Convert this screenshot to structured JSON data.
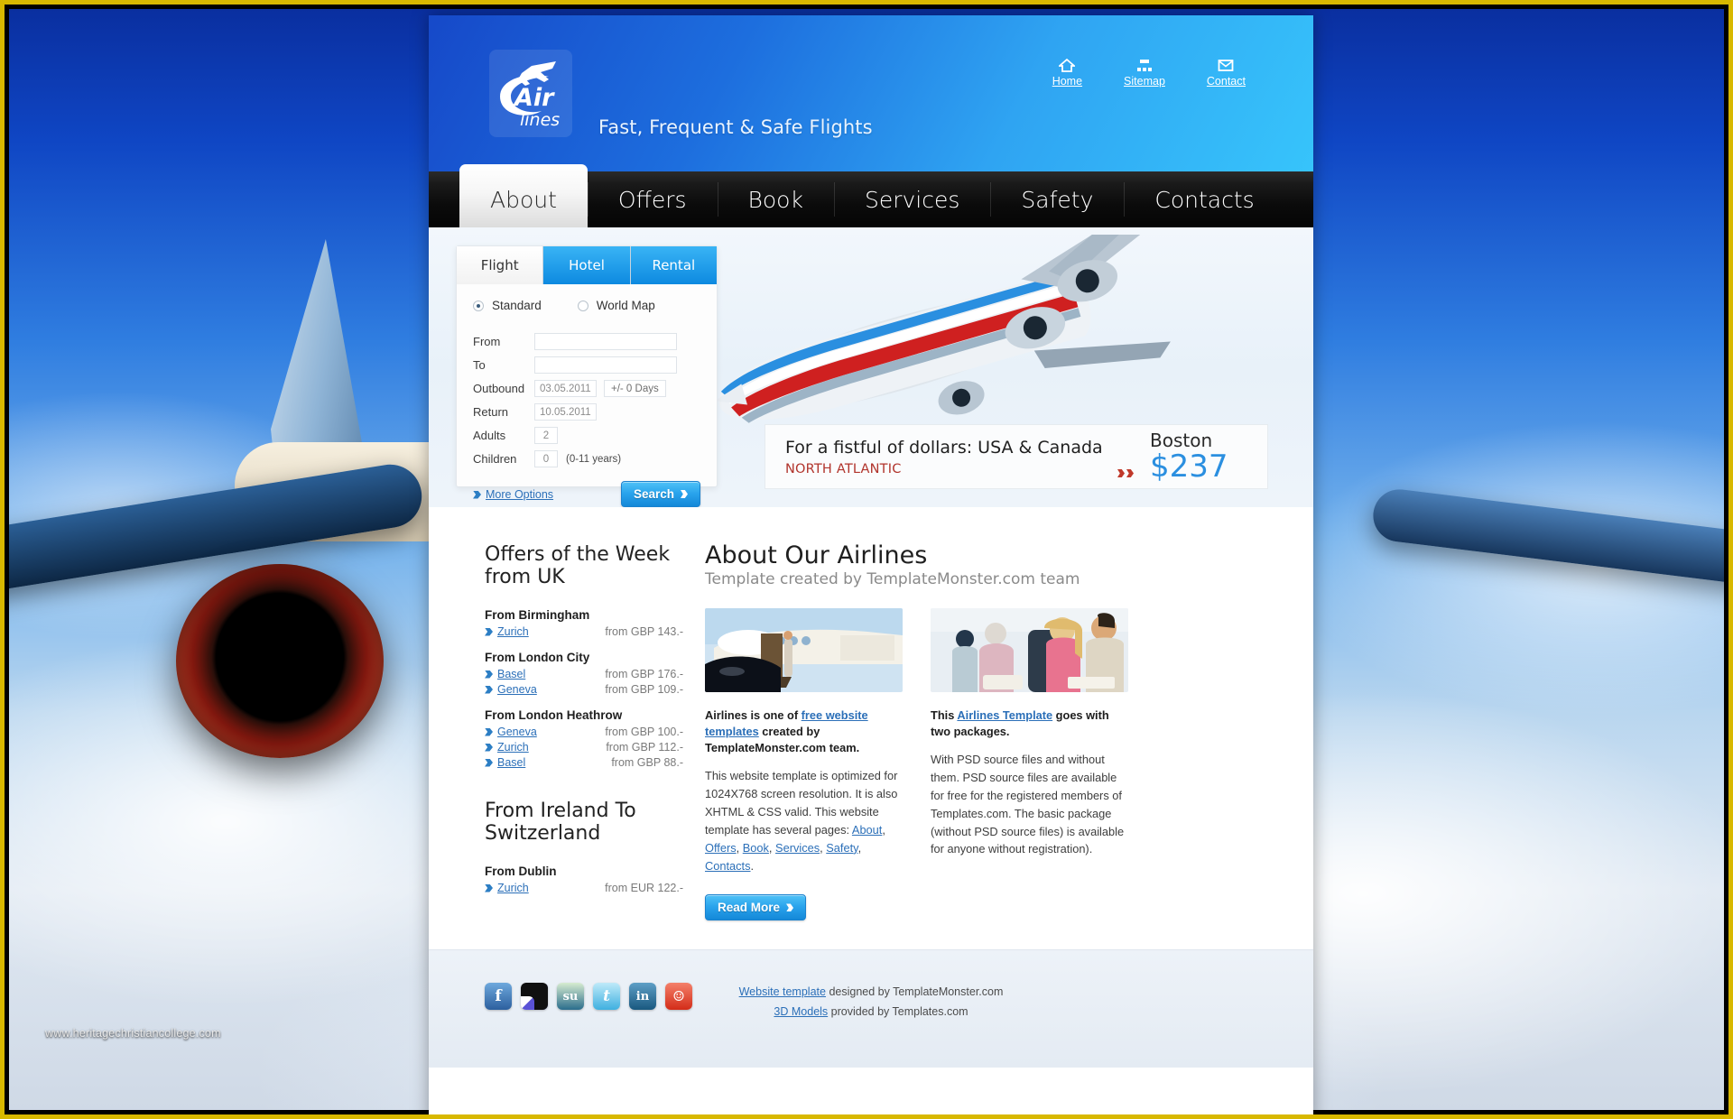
{
  "background": {
    "watermark": "www.heritagechristiancollege.com",
    "frame_color": "#d8b800"
  },
  "header": {
    "logo_top": "Air",
    "logo_bottom": "lines",
    "tagline": "Fast, Frequent & Safe Flights",
    "top_links": [
      {
        "label": "Home",
        "icon": "home-icon"
      },
      {
        "label": "Sitemap",
        "icon": "sitemap-icon"
      },
      {
        "label": "Contact",
        "icon": "envelope-icon"
      }
    ]
  },
  "nav": {
    "items": [
      {
        "label": "About",
        "active": true
      },
      {
        "label": "Offers",
        "active": false
      },
      {
        "label": "Book",
        "active": false
      },
      {
        "label": "Services",
        "active": false
      },
      {
        "label": "Safety",
        "active": false
      },
      {
        "label": "Contacts",
        "active": false
      }
    ]
  },
  "booking": {
    "tabs": [
      {
        "label": "Flight",
        "active": true
      },
      {
        "label": "Hotel",
        "active": false
      },
      {
        "label": "Rental",
        "active": false
      }
    ],
    "modes": [
      {
        "label": "Standard",
        "selected": true
      },
      {
        "label": "World Map",
        "selected": false
      }
    ],
    "fields": {
      "from_label": "From",
      "from_value": "",
      "to_label": "To",
      "to_value": "",
      "outbound_label": "Outbound",
      "outbound_value": "03.05.2011",
      "return_label": "Return",
      "return_value": "10.05.2011",
      "days_note": "+/- 0 Days",
      "adults_label": "Adults",
      "adults_value": "2",
      "children_label": "Children",
      "children_value": "0",
      "children_note": "(0-11 years)"
    },
    "more_options": "More Options",
    "search_button": "Search"
  },
  "offer_strip": {
    "title": "For a fistful of dollars: USA & Canada",
    "subtitle": "NORTH ATLANTIC",
    "city": "Boston",
    "price": "$237"
  },
  "sidebar": {
    "heading_1": "Offers of the Week from UK",
    "groups_1": [
      {
        "title": "From Birmingham",
        "rows": [
          {
            "city": "Zurich",
            "price": "from GBP 143.-"
          }
        ]
      },
      {
        "title": "From London City",
        "rows": [
          {
            "city": "Basel",
            "price": "from GBP 176.-"
          },
          {
            "city": "Geneva",
            "price": "from GBP 109.-"
          }
        ]
      },
      {
        "title": "From London Heathrow",
        "rows": [
          {
            "city": "Geneva",
            "price": "from GBP 100.-"
          },
          {
            "city": "Zurich",
            "price": "from GBP 112.-"
          },
          {
            "city": "Basel",
            "price": "from GBP 88.-"
          }
        ]
      }
    ],
    "heading_2": "From Ireland To Switzerland",
    "groups_2": [
      {
        "title": "From Dublin",
        "rows": [
          {
            "city": "Zurich",
            "price": "from EUR 122.-"
          }
        ]
      }
    ]
  },
  "about": {
    "title": "About Our Airlines",
    "subtitle": "Template created by TemplateMonster.com team",
    "left": {
      "lead_pre": "Airlines is one of ",
      "lead_link": "free website templates",
      "lead_post": " created by TemplateMonster.com team.",
      "body_pre": "This website template is optimized for 1024X768 screen resolution. It is also XHTML & CSS valid. This website template has several pages: ",
      "page_links": [
        "About",
        "Offers",
        "Book",
        "Services",
        "Safety",
        "Contacts"
      ]
    },
    "right": {
      "lead_pre": "This ",
      "lead_link": "Airlines Template",
      "lead_post": " goes with two packages.",
      "body": "With PSD source files and without them. PSD source files are available for free for the registered members of Templates.com. The basic package (without PSD source files) is available for anyone without registration)."
    },
    "read_more": "Read More"
  },
  "footer": {
    "social": [
      {
        "name": "facebook-icon",
        "glyph": "f",
        "color": "#3b7cc4"
      },
      {
        "name": "delicious-icon",
        "glyph": "",
        "color": "#ffffff"
      },
      {
        "name": "stumbleupon-icon",
        "glyph": "su",
        "color": "#5f9f4f"
      },
      {
        "name": "twitter-icon",
        "glyph": "t",
        "color": "#56c2ee"
      },
      {
        "name": "linkedin-icon",
        "glyph": "in",
        "color": "#2a77a8"
      },
      {
        "name": "reddit-icon",
        "glyph": "☺",
        "color": "#e23b24"
      }
    ],
    "line1_link": "Website template",
    "line1_text": " designed by TemplateMonster.com",
    "line2_link": "3D Models",
    "line2_text": " provided by Templates.com"
  }
}
